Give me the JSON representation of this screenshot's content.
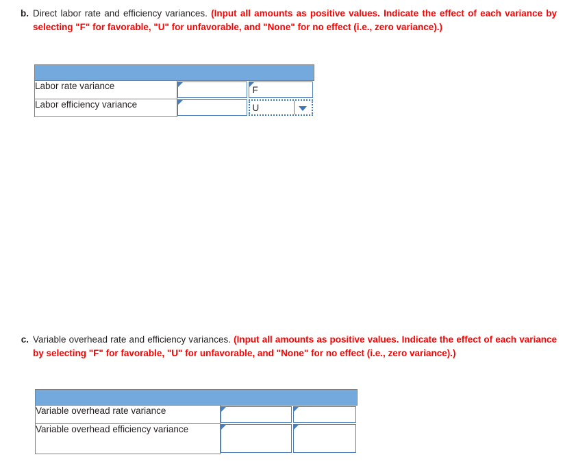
{
  "theme": {
    "header_fill": "#74a9de",
    "field_border": "#4a7ebb",
    "focus_border": "#3a74bd",
    "instruction_color": "#fe0000",
    "text_color": "#231f20",
    "cell_border": "#808080",
    "page_background": "#ffffff"
  },
  "sections": {
    "b": {
      "letter": "b.",
      "prompt": "Direct labor rate and efficiency variances.",
      "instruction": "(Input all amounts as positive values. Indicate the effect of each variance by selecting \"F\" for favorable, \"U\" for unfavorable, and \"None\" for no effect (i.e., zero variance).)",
      "table": {
        "header_label": "",
        "rows": [
          {
            "label": "Labor rate variance",
            "amount": "",
            "amount_placeholder": "",
            "effect": "F",
            "effect_widget": "textbox"
          },
          {
            "label": "Labor efficiency variance",
            "amount": "",
            "amount_placeholder": "",
            "effect": "U",
            "effect_widget": "dropdown-focused"
          }
        ]
      }
    },
    "c": {
      "letter": "c.",
      "prompt": "Variable overhead rate and efficiency variances.",
      "instruction": "(Input all amounts as positive values. Indicate the effect of each variance by selecting \"F\" for favorable, \"U\" for unfavorable, and \"None\" for no effect (i.e., zero variance).)",
      "table": {
        "header_label": "",
        "rows": [
          {
            "label": "Variable overhead rate variance",
            "amount": "",
            "amount_placeholder": "",
            "effect": "",
            "effect_widget": "textbox"
          },
          {
            "label": "Variable overhead efficiency variance",
            "amount": "",
            "amount_placeholder": "",
            "effect": "",
            "effect_widget": "textbox"
          }
        ]
      }
    }
  },
  "dropdown_options": [
    "F",
    "U",
    "None"
  ]
}
